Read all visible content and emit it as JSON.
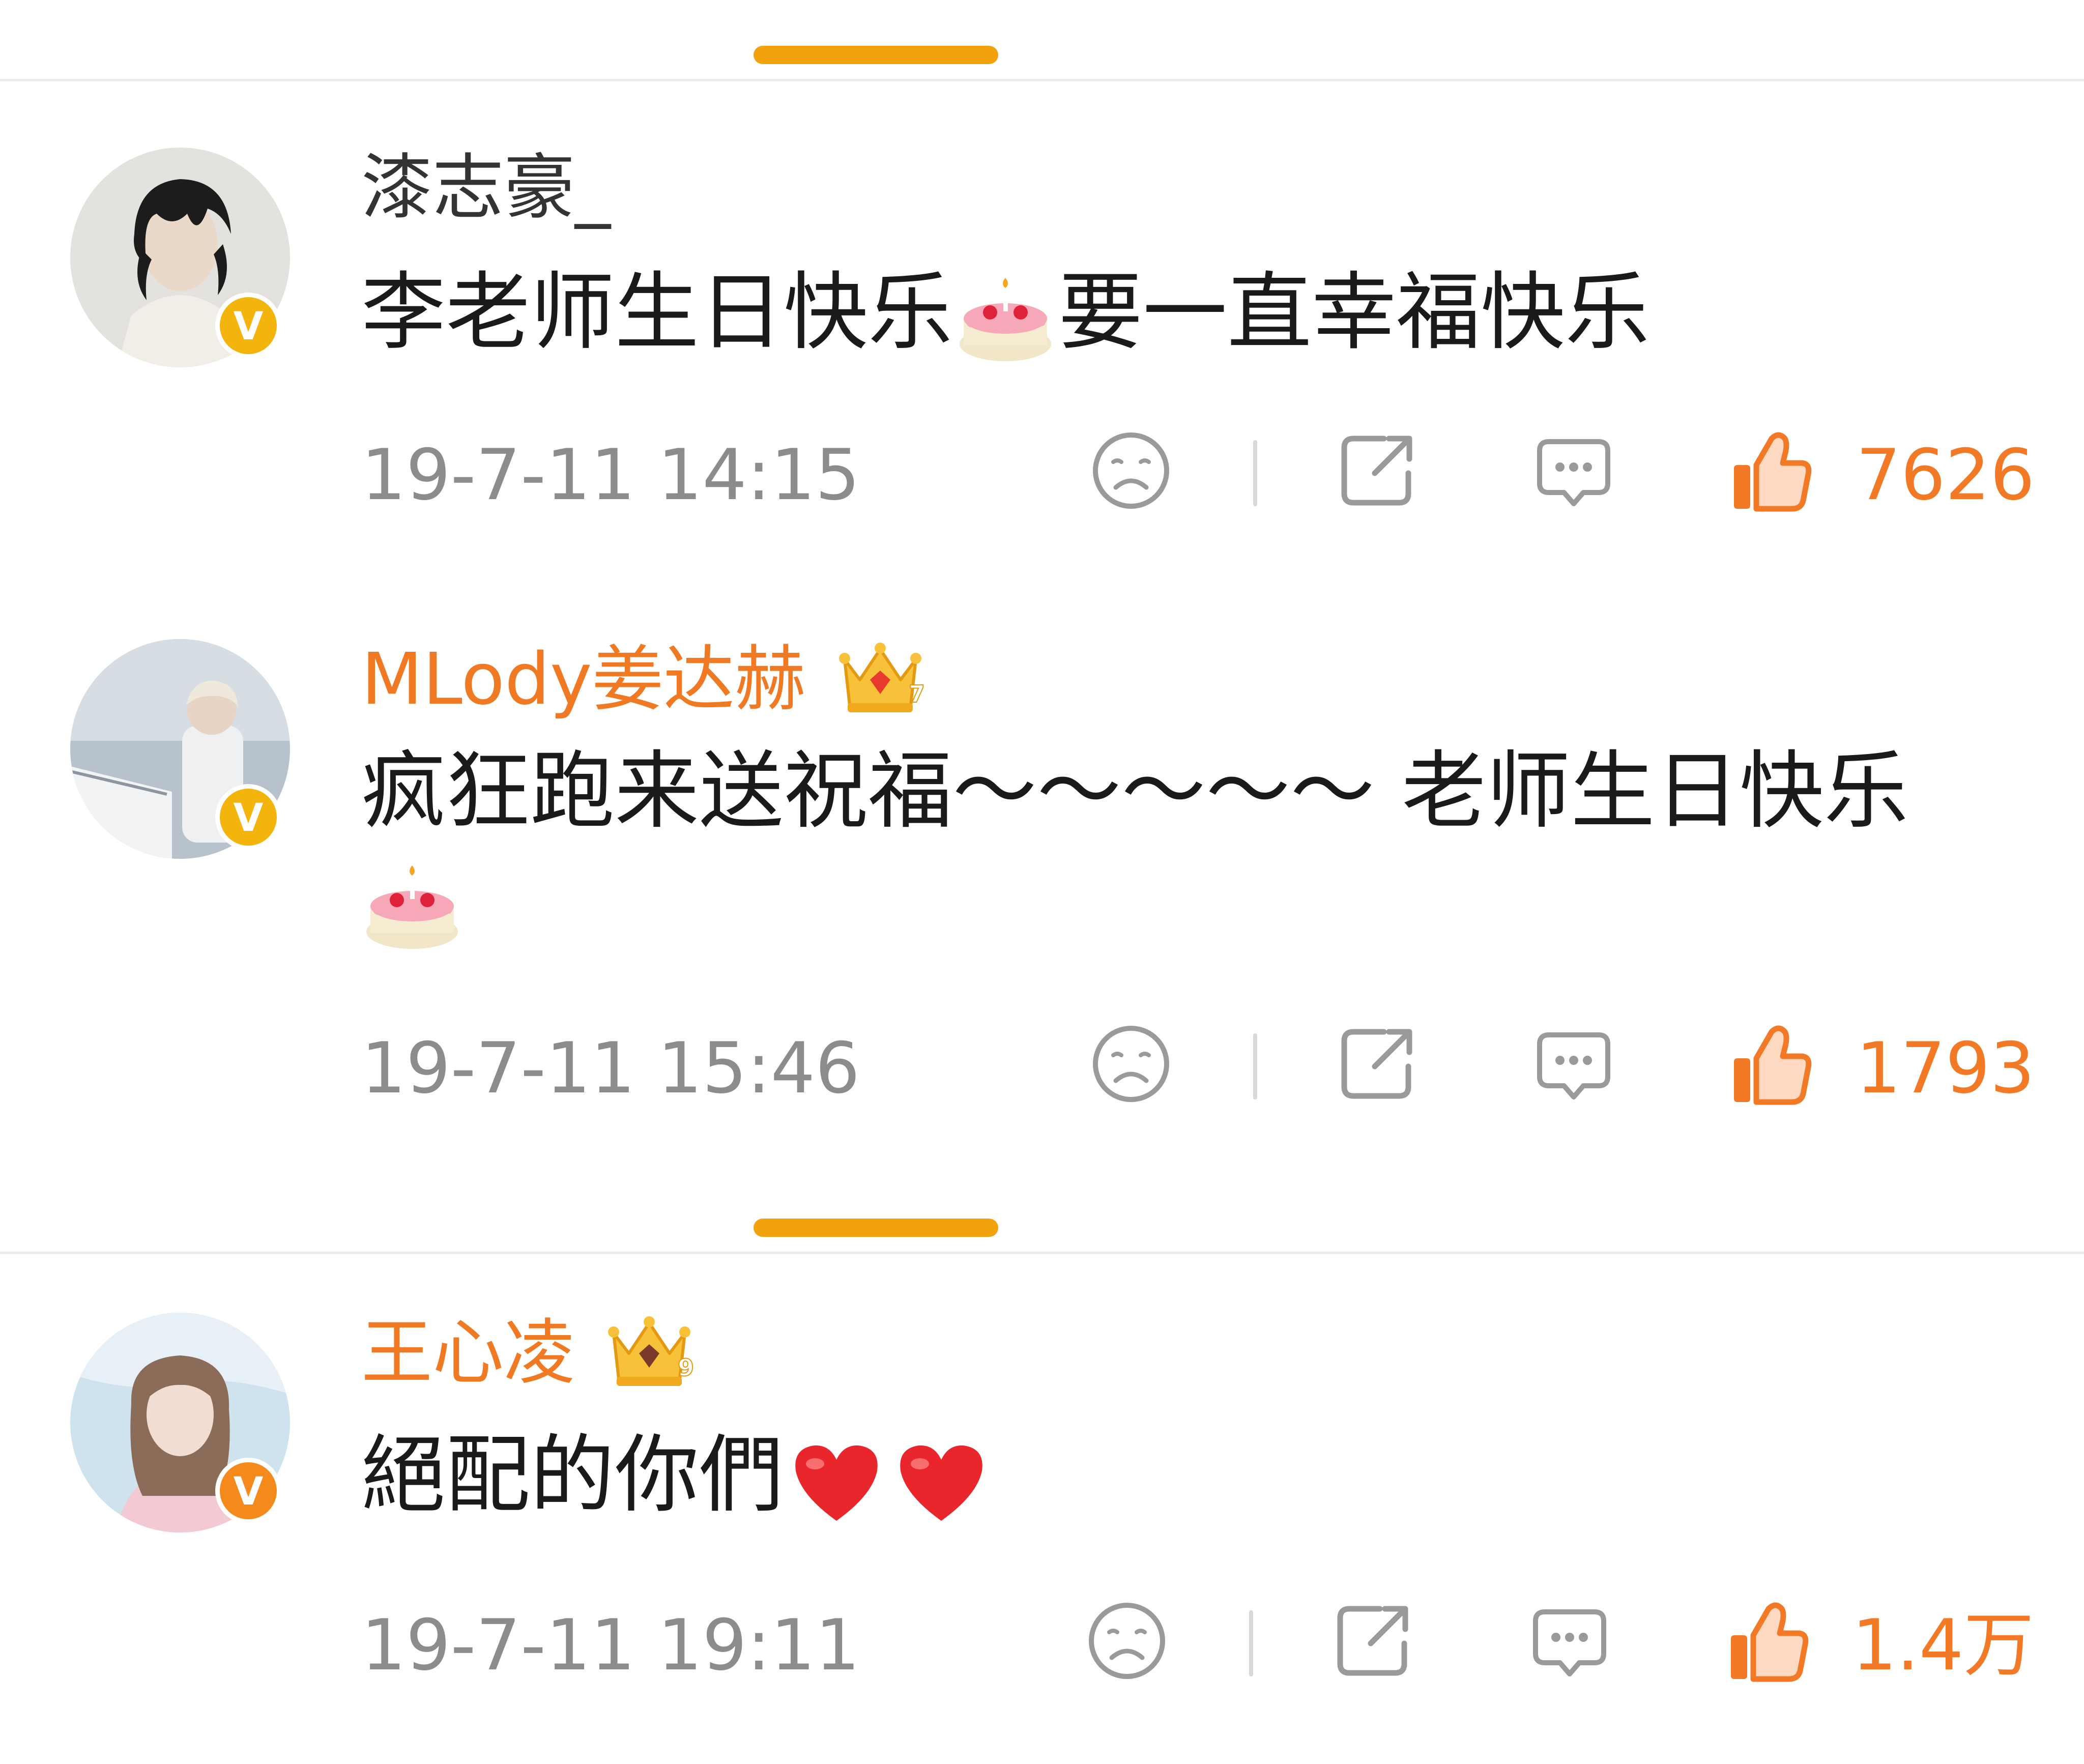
{
  "colors": {
    "accent_orange": "#f2a20d",
    "username_orange": "#f07a24",
    "like_orange": "#f27a26",
    "verified_gold": "#f3b40b",
    "verified_orange": "#f58a1c",
    "gray_text": "#8c8c8c",
    "icon_gray": "#9a9a9a",
    "divider": "#ececec",
    "body_text": "#1a1a1a",
    "heart_red": "#e8262c"
  },
  "comments": [
    {
      "username": "漆志豪_",
      "username_style": "plain",
      "badge": "v",
      "badge_color": "gold",
      "crown": null,
      "text_before_emoji": "李老师生日快乐",
      "inline_emoji": "cake-emoji",
      "text_after_emoji": "要一直幸福快乐",
      "timestamp": "19-7-11 14:15",
      "like_count": "7626"
    },
    {
      "username": "MLody姜达赫",
      "username_style": "vip",
      "badge": "v",
      "badge_color": "gold",
      "crown": "crown-level-7-icon",
      "crown_level": "7",
      "text_line1": "疯狂跑来送祝福～～～～～ 老师生日快乐",
      "trailing_emoji": "cake-emoji",
      "timestamp": "19-7-11 15:46",
      "like_count": "1793"
    },
    {
      "username": "王心凌",
      "username_style": "vip",
      "badge": "v",
      "badge_color": "orange",
      "crown": "crown-level-9-icon",
      "crown_level": "9",
      "text": "絕配的你們",
      "trailing_emojis": [
        "heart-emoji",
        "heart-emoji"
      ],
      "timestamp": "19-7-11 19:11",
      "like_count": "1.4万"
    }
  ],
  "actions": {
    "dislike": "sad-face-icon",
    "share": "share-icon",
    "reply": "comment-bubble-icon",
    "like": "thumbs-up-icon"
  }
}
